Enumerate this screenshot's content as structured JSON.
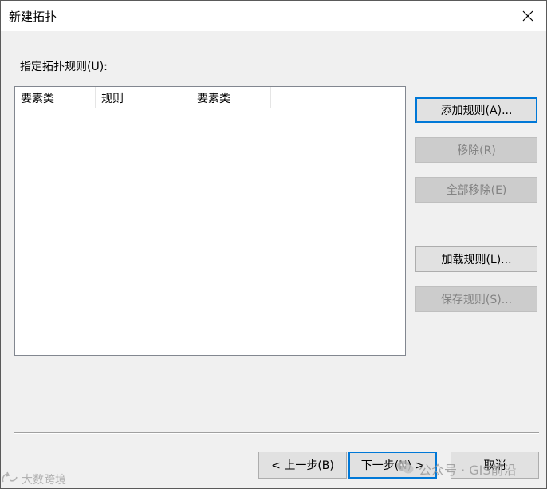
{
  "window": {
    "title": "新建拓扑"
  },
  "prompt": {
    "label": "指定拓扑规则(U):"
  },
  "rules_list": {
    "columns": [
      "要素类",
      "规则",
      "要素类"
    ],
    "rows": []
  },
  "side_buttons": {
    "add_rule": "添加规则(A)...",
    "remove": "移除(R)",
    "remove_all": "全部移除(E)",
    "load_rules": "加载规则(L)...",
    "save_rules": "保存规则(S)..."
  },
  "footer": {
    "back": "< 上一步(B)",
    "next": "下一步(N) >",
    "cancel": "取消"
  },
  "watermarks": {
    "left": "大数跨境",
    "right": "公众号 · GIS前沿"
  },
  "colors": {
    "default_button_border": "#0078d7",
    "dialog_background": "#f0f0f0"
  }
}
